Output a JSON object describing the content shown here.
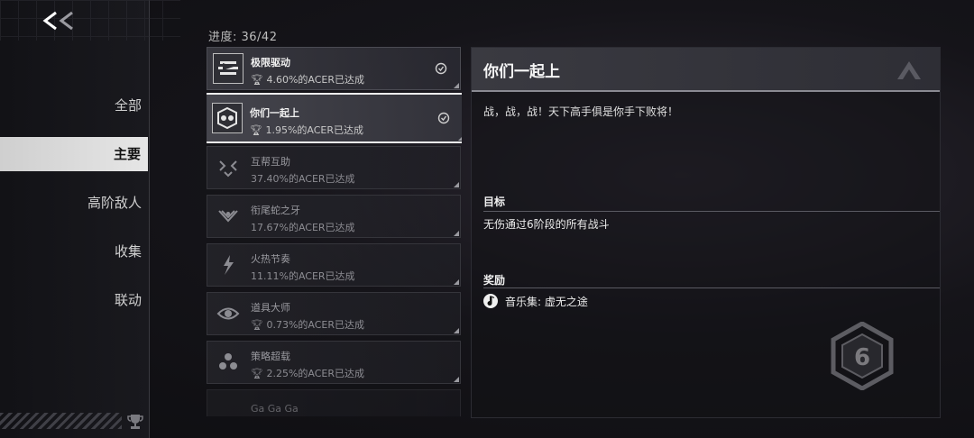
{
  "nav": {
    "items": [
      {
        "label": "全部"
      },
      {
        "label": "主要"
      },
      {
        "label": "高阶敌人"
      },
      {
        "label": "收集"
      },
      {
        "label": "联动"
      }
    ]
  },
  "progress": {
    "label": "进度: 36/42"
  },
  "achievements": [
    {
      "title": "极限驱动",
      "percent": "4.60%的ACER已达成",
      "completed": true
    },
    {
      "title": "你们一起上",
      "percent": "1.95%的ACER已达成",
      "completed": true
    },
    {
      "title": "互帮互助",
      "percent": "37.40%的ACER已达成",
      "completed": false
    },
    {
      "title": "衔尾蛇之牙",
      "percent": "17.67%的ACER已达成",
      "completed": false
    },
    {
      "title": "火热节奏",
      "percent": "11.11%的ACER已达成",
      "completed": false
    },
    {
      "title": "道具大师",
      "percent": "0.73%的ACER已达成",
      "completed": false
    },
    {
      "title": "策略超载",
      "percent": "2.25%的ACER已达成",
      "completed": false
    },
    {
      "title": "Ga Ga Ga",
      "percent": "",
      "completed": false
    }
  ],
  "detail": {
    "title": "你们一起上",
    "description": "战，战，战！天下高手俱是你手下败将！",
    "goal_label": "目标",
    "goal_text": "无伤通过6阶段的所有战斗",
    "reward_label": "奖励",
    "reward_text": "音乐集: 虚无之途",
    "badge_number": "6"
  },
  "colors": {
    "accent": "#f2f2f2",
    "panel": "#2e2e35"
  }
}
